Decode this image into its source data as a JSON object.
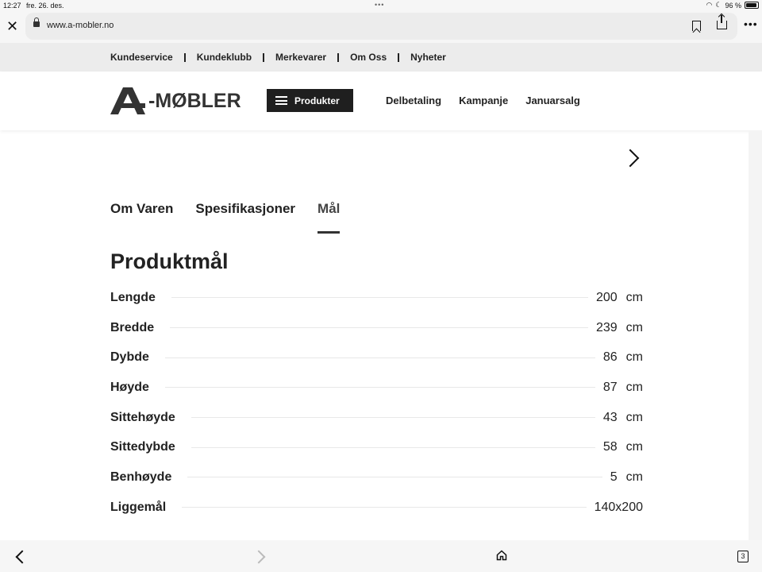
{
  "status_bar": {
    "time": "12:27",
    "date": "fre. 26. des.",
    "battery": "96 %"
  },
  "browser": {
    "url": "www.a-mobler.no",
    "tab_count": "3"
  },
  "topnav": {
    "items": [
      "Kundeservice",
      "Kundeklubb",
      "Merkevarer",
      "Om Oss",
      "Nyheter"
    ]
  },
  "header": {
    "logo_text": "-MØBLER",
    "produkter_label": "Produkter",
    "links": [
      "Delbetaling",
      "Kampanje",
      "Januarsalg"
    ]
  },
  "tabs": {
    "items": [
      "Om Varen",
      "Spesifikasjoner",
      "Mål"
    ],
    "active_index": 2
  },
  "section_title": "Produktmål",
  "dimensions": [
    {
      "label": "Lengde",
      "value": "200",
      "unit": "cm"
    },
    {
      "label": "Bredde",
      "value": "239",
      "unit": "cm"
    },
    {
      "label": "Dybde",
      "value": "86",
      "unit": "cm"
    },
    {
      "label": "Høyde",
      "value": "87",
      "unit": "cm"
    },
    {
      "label": "Sittehøyde",
      "value": "43",
      "unit": "cm"
    },
    {
      "label": "Sittedybde",
      "value": "58",
      "unit": "cm"
    },
    {
      "label": "Benhøyde",
      "value": "5",
      "unit": "cm"
    },
    {
      "label": "Liggemål",
      "value": "140x200",
      "unit": ""
    }
  ],
  "colors": {
    "dark": "#1f1f1f",
    "nav_bg": "#ececec"
  },
  "icons": [
    "close-icon",
    "lock-icon",
    "bookmark-icon",
    "share-icon",
    "more-icon",
    "menu-icon",
    "chevron-right-icon",
    "back-icon",
    "forward-icon",
    "home-icon",
    "tabs-icon"
  ]
}
